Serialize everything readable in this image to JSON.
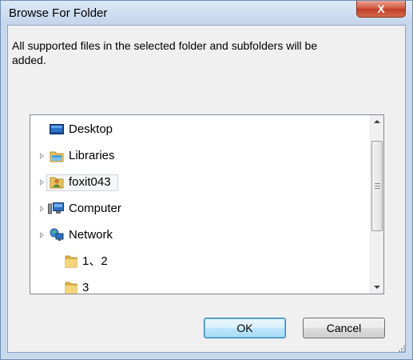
{
  "window": {
    "title": "Browse For Folder",
    "close_glyph": "X"
  },
  "description": "All supported files in the selected folder and subfolders will be added.",
  "tree": {
    "items": [
      {
        "label": "Desktop",
        "icon": "desktop-icon",
        "expandable": false,
        "selected": false
      },
      {
        "label": "Libraries",
        "icon": "libraries-icon",
        "expandable": true,
        "selected": false
      },
      {
        "label": "foxit043",
        "icon": "user-folder-icon",
        "expandable": true,
        "selected": true
      },
      {
        "label": "Computer",
        "icon": "computer-icon",
        "expandable": true,
        "selected": false
      },
      {
        "label": "Network",
        "icon": "network-icon",
        "expandable": true,
        "selected": false
      },
      {
        "label": "1、2",
        "icon": "folder-icon",
        "expandable": false,
        "selected": false
      },
      {
        "label": "3",
        "icon": "folder-icon",
        "expandable": false,
        "selected": false
      }
    ]
  },
  "buttons": {
    "ok": "OK",
    "cancel": "Cancel"
  },
  "colors": {
    "frame": "#c9d9ec",
    "close_button": "#d2533a",
    "ok_button": "#bee6fd",
    "selection": "#f4f6f8"
  }
}
